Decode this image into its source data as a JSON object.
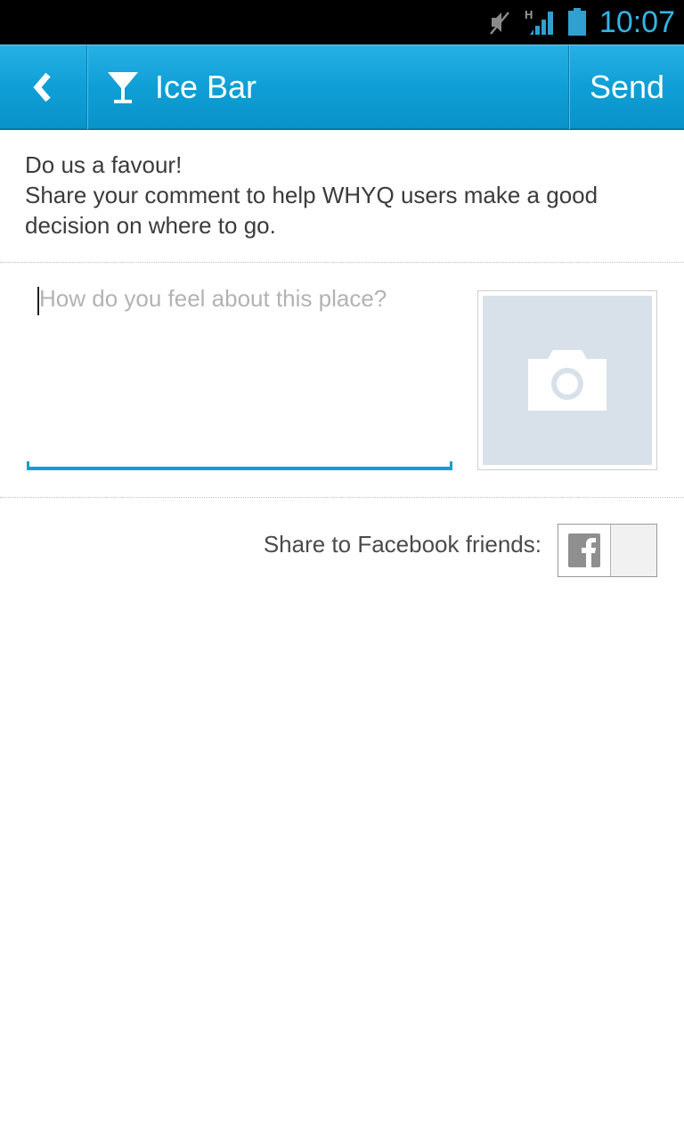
{
  "status_bar": {
    "time": "10:07",
    "network_label": "H",
    "icons": [
      "mute-icon",
      "signal-icon",
      "battery-icon"
    ],
    "accent_color": "#33b5e5"
  },
  "action_bar": {
    "title": "Ice Bar",
    "send_label": "Send",
    "back_icon": "chevron-left-icon",
    "title_icon": "cocktail-glass-icon",
    "bg_color": "#0f9fd6"
  },
  "intro": {
    "line1": "Do us a favour!",
    "line2": "Share your comment to help WHYQ users make a good decision on where to go."
  },
  "comment": {
    "placeholder": "How do you feel about this place?",
    "value": ""
  },
  "photo": {
    "icon": "camera-icon"
  },
  "share": {
    "label": "Share to Facebook friends:",
    "icon": "facebook-icon",
    "enabled": false
  }
}
